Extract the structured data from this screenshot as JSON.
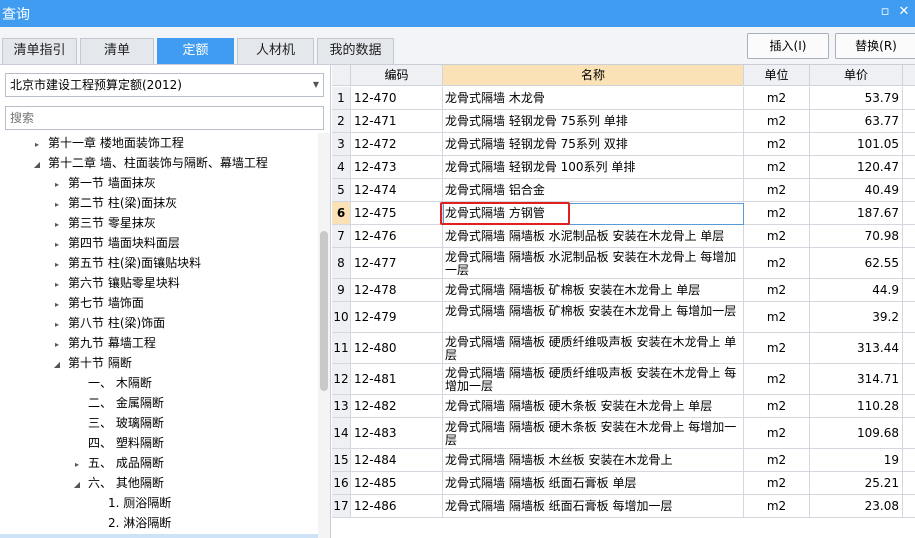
{
  "title": "查询",
  "window_buttons": {
    "restore": "▫",
    "close": "✕"
  },
  "tabs": [
    {
      "label": "清单指引"
    },
    {
      "label": "清单"
    },
    {
      "label": "定额"
    },
    {
      "label": "人材机"
    },
    {
      "label": "我的数据"
    }
  ],
  "actions": {
    "insert": "插入(I)",
    "replace": "替换(R)"
  },
  "left": {
    "library": "北京市建设工程预算定额(2012)",
    "search_placeholder": "搜索",
    "tree": [
      {
        "label": "第十一章 楼地面装饰工程",
        "expander": "▸"
      },
      {
        "label": "第十二章 墙、柱面装饰与隔断、幕墙工程",
        "expander": "◢"
      },
      {
        "label": "第一节 墙面抹灰",
        "expander": "▸"
      },
      {
        "label": "第二节 柱(梁)面抹灰",
        "expander": "▸"
      },
      {
        "label": "第三节 零星抹灰",
        "expander": "▸"
      },
      {
        "label": "第四节 墙面块料面层",
        "expander": "▸"
      },
      {
        "label": "第五节 柱(梁)面镶贴块料",
        "expander": "▸"
      },
      {
        "label": "第六节 镶贴零星块料",
        "expander": "▸"
      },
      {
        "label": "第七节 墙饰面",
        "expander": "▸"
      },
      {
        "label": "第八节 柱(梁)饰面",
        "expander": "▸"
      },
      {
        "label": "第九节 幕墙工程",
        "expander": "▸"
      },
      {
        "label": "第十节 隔断",
        "expander": "◢"
      },
      {
        "label": "一、 木隔断",
        "expander": ""
      },
      {
        "label": "二、 金属隔断",
        "expander": ""
      },
      {
        "label": "三、 玻璃隔断",
        "expander": ""
      },
      {
        "label": "四、 塑料隔断",
        "expander": ""
      },
      {
        "label": "五、 成品隔断",
        "expander": "▸"
      },
      {
        "label": "六、 其他隔断",
        "expander": "◢"
      },
      {
        "label": "1. 厕浴隔断",
        "expander": ""
      },
      {
        "label": "2. 淋浴隔断",
        "expander": ""
      }
    ]
  },
  "grid": {
    "headers": {
      "code": "编码",
      "name": "名称",
      "unit": "单位",
      "price": "单价"
    },
    "rows": [
      {
        "num": "1",
        "code": "12-470",
        "name": "龙骨式隔墙 木龙骨",
        "unit": "m2",
        "price": "53.79"
      },
      {
        "num": "2",
        "code": "12-471",
        "name": "龙骨式隔墙 轻钢龙骨 75系列 单排",
        "unit": "m2",
        "price": "63.77"
      },
      {
        "num": "3",
        "code": "12-472",
        "name": "龙骨式隔墙 轻钢龙骨 75系列 双排",
        "unit": "m2",
        "price": "101.05"
      },
      {
        "num": "4",
        "code": "12-473",
        "name": "龙骨式隔墙 轻钢龙骨 100系列 单排",
        "unit": "m2",
        "price": "120.47"
      },
      {
        "num": "5",
        "code": "12-474",
        "name": "龙骨式隔墙 铝合金",
        "unit": "m2",
        "price": "40.49"
      },
      {
        "num": "6",
        "code": "12-475",
        "name": "龙骨式隔墙 方钢管",
        "unit": "m2",
        "price": "187.67"
      },
      {
        "num": "7",
        "code": "12-476",
        "name": "龙骨式隔墙 隔墙板 水泥制品板 安装在木龙骨上 单层",
        "unit": "m2",
        "price": "70.98"
      },
      {
        "num": "8",
        "code": "12-477",
        "name": "龙骨式隔墙 隔墙板 水泥制品板 安装在木龙骨上 每增加一层",
        "unit": "m2",
        "price": "62.55"
      },
      {
        "num": "9",
        "code": "12-478",
        "name": "龙骨式隔墙 隔墙板 矿棉板 安装在木龙骨上 单层",
        "unit": "m2",
        "price": "44.9"
      },
      {
        "num": "10",
        "code": "12-479",
        "name": "龙骨式隔墙 隔墙板 矿棉板 安装在木龙骨上 每增加一层",
        "unit": "m2",
        "price": "39.2"
      },
      {
        "num": "11",
        "code": "12-480",
        "name": "龙骨式隔墙 隔墙板 硬质纤维吸声板 安装在木龙骨上 单层",
        "unit": "m2",
        "price": "313.44"
      },
      {
        "num": "12",
        "code": "12-481",
        "name": "龙骨式隔墙 隔墙板 硬质纤维吸声板 安装在木龙骨上 每增加一层",
        "unit": "m2",
        "price": "314.71"
      },
      {
        "num": "13",
        "code": "12-482",
        "name": "龙骨式隔墙 隔墙板 硬木条板 安装在木龙骨上 单层",
        "unit": "m2",
        "price": "110.28"
      },
      {
        "num": "14",
        "code": "12-483",
        "name": "龙骨式隔墙 隔墙板 硬木条板 安装在木龙骨上 每增加一层",
        "unit": "m2",
        "price": "109.68"
      },
      {
        "num": "15",
        "code": "12-484",
        "name": "龙骨式隔墙 隔墙板 木丝板 安装在木龙骨上",
        "unit": "m2",
        "price": "19"
      },
      {
        "num": "16",
        "code": "12-485",
        "name": "龙骨式隔墙 隔墙板 纸面石膏板 单层",
        "unit": "m2",
        "price": "25.21"
      },
      {
        "num": "17",
        "code": "12-486",
        "name": "龙骨式隔墙 隔墙板 纸面石膏板 每增加一层",
        "unit": "m2",
        "price": "23.08"
      }
    ]
  },
  "colors": {
    "accent": "#3f9cf0",
    "highlight": "#e02020",
    "header_selected": "#fbe2b6"
  }
}
